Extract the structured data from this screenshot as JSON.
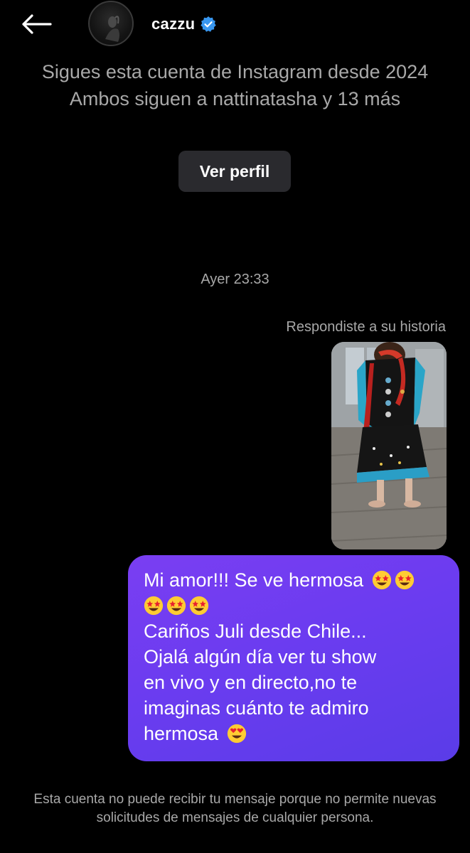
{
  "header": {
    "back_icon": "arrow-left-icon",
    "username": "cazzu",
    "verified_icon": "verified-badge-icon",
    "verified_color": "#3897f0"
  },
  "profile_info": {
    "line1": "Sigues esta cuenta de Instagram desde 2024",
    "line2": "Ambos siguen a nattinatasha y 13 más",
    "view_profile_label": "Ver perfil"
  },
  "thread": {
    "timestamp": "Ayer 23:33",
    "reply_label": "Respondiste a su historia",
    "message": {
      "lines": [
        "Mi amor!!! Se ve hermosa",
        "",
        "Cariños Juli desde Chile...",
        "Ojalá algún día ver tu show",
        "en vivo y en directo,no te",
        "imaginas cuánto te admiro",
        "hermosa"
      ],
      "emojis": [
        "star-struck",
        "star-struck",
        "star-struck",
        "star-struck",
        "star-struck",
        "heart-eyes"
      ],
      "bubble_color": "#6b3cf0"
    }
  },
  "footer": {
    "notice": "Esta cuenta no puede recibir tu mensaje porque no permite nuevas solicitudes de mensajes de cualquier persona."
  }
}
